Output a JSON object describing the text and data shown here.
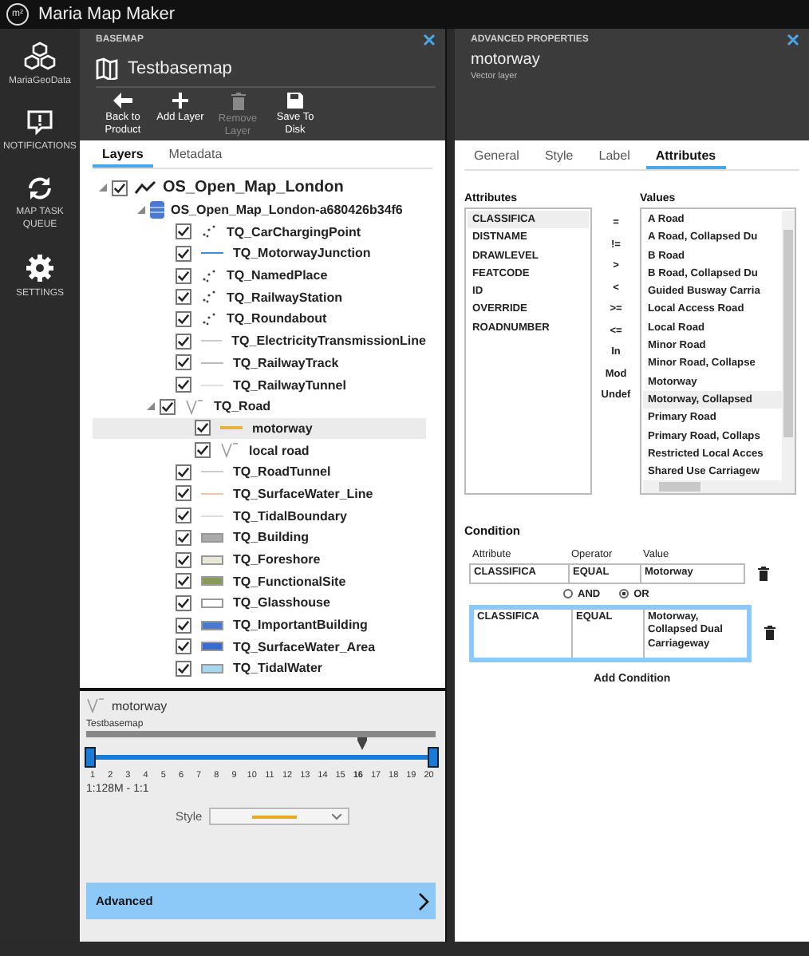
{
  "app": {
    "title": "Maria Map Maker",
    "logo": "m²"
  },
  "sidebar": [
    {
      "label": "MariaGeoData"
    },
    {
      "label": "NOTIFICATIONS"
    },
    {
      "label": "MAP TASK QUEUE"
    },
    {
      "label": "SETTINGS"
    }
  ],
  "basemap": {
    "header": "BASEMAP",
    "title": "Testbasemap",
    "toolbar": [
      {
        "label": "Back to Product",
        "disabled": false
      },
      {
        "label": "Add Layer",
        "disabled": false
      },
      {
        "label": "Remove Layer",
        "disabled": true
      },
      {
        "label": "Save To Disk",
        "disabled": false
      }
    ],
    "tabs": [
      {
        "label": "Layers",
        "selected": true
      },
      {
        "label": "Metadata",
        "selected": false
      }
    ],
    "tree": [
      {
        "label": "OS_Open_Map_London",
        "kind": "group",
        "checked": true,
        "expanded": true,
        "selected": false,
        "children": [
          {
            "label": "OS_Open_Map_London-a680426b34f6",
            "kind": "dataset",
            "expanded": true,
            "selected": false,
            "children": [
              {
                "label": "TQ_CarChargingPoint",
                "kind": "points",
                "checked": true,
                "selected": false
              },
              {
                "label": "TQ_MotorwayJunction",
                "kind": "line",
                "color": "#3a8fd8",
                "checked": true,
                "selected": false
              },
              {
                "label": "TQ_NamedPlace",
                "kind": "points",
                "checked": true,
                "selected": false
              },
              {
                "label": "TQ_RailwayStation",
                "kind": "points",
                "checked": true,
                "selected": false
              },
              {
                "label": "TQ_Roundabout",
                "kind": "points",
                "checked": true,
                "selected": false
              },
              {
                "label": "TQ_ElectricityTransmissionLine",
                "kind": "line",
                "color": "#cccccc",
                "checked": true,
                "selected": false
              },
              {
                "label": "TQ_RailwayTrack",
                "kind": "line",
                "color": "#bbbbbb",
                "checked": true,
                "selected": false
              },
              {
                "label": "TQ_RailwayTunnel",
                "kind": "line",
                "color": "#dddddd",
                "checked": true,
                "selected": false
              },
              {
                "label": "TQ_Road",
                "kind": "road",
                "checked": true,
                "expanded": true,
                "selected": false,
                "children": [
                  {
                    "label": "motorway",
                    "kind": "line",
                    "color": "#e8b040",
                    "checked": true,
                    "selected": true
                  },
                  {
                    "label": "local road",
                    "kind": "road",
                    "checked": true,
                    "selected": false
                  }
                ]
              },
              {
                "label": "TQ_RoadTunnel",
                "kind": "line",
                "color": "#cccccc",
                "checked": true,
                "selected": false
              },
              {
                "label": "TQ_SurfaceWater_Line",
                "kind": "line",
                "color": "#f0c8a8",
                "checked": true,
                "selected": false
              },
              {
                "label": "TQ_TidalBoundary",
                "kind": "line",
                "color": "#dddddd",
                "checked": true,
                "selected": false
              },
              {
                "label": "TQ_Building",
                "kind": "polygon",
                "color": "#aaaaaa",
                "checked": true,
                "selected": false
              },
              {
                "label": "TQ_Foreshore",
                "kind": "polygon",
                "color": "#e8e8d8",
                "checked": true,
                "selected": false
              },
              {
                "label": "TQ_FunctionalSite",
                "kind": "polygon",
                "color": "#8a9a5a",
                "checked": true,
                "selected": false
              },
              {
                "label": "TQ_Glasshouse",
                "kind": "polygon",
                "color": "#ffffff",
                "checked": true,
                "selected": false
              },
              {
                "label": "TQ_ImportantBuilding",
                "kind": "polygon",
                "color": "#4a7ad0",
                "checked": true,
                "selected": false
              },
              {
                "label": "TQ_SurfaceWater_Area",
                "kind": "polygon",
                "color": "#3a6ad0",
                "checked": true,
                "selected": false
              },
              {
                "label": "TQ_TidalWater",
                "kind": "polygon",
                "color": "#a8d8f0",
                "checked": true,
                "selected": false
              }
            ]
          }
        ]
      }
    ]
  },
  "detail": {
    "layer": "motorway",
    "basemap": "Testbasemap",
    "level": 1,
    "ticks": [
      {
        "label": "1",
        "selected": false
      },
      {
        "label": "2",
        "selected": false
      },
      {
        "label": "3",
        "selected": false
      },
      {
        "label": "4",
        "selected": false
      },
      {
        "label": "5",
        "selected": false
      },
      {
        "label": "6",
        "selected": false
      },
      {
        "label": "7",
        "selected": false
      },
      {
        "label": "8",
        "selected": false
      },
      {
        "label": "9",
        "selected": false
      },
      {
        "label": "10",
        "selected": false
      },
      {
        "label": "11",
        "selected": false
      },
      {
        "label": "12",
        "selected": false
      },
      {
        "label": "13",
        "selected": false
      },
      {
        "label": "14",
        "selected": false
      },
      {
        "label": "15",
        "selected": false
      },
      {
        "label": "16",
        "selected": true
      },
      {
        "label": "17",
        "selected": false
      },
      {
        "label": "18",
        "selected": false
      },
      {
        "label": "19",
        "selected": false
      },
      {
        "label": "20",
        "selected": false
      }
    ],
    "scale": "1:128M - 1:1",
    "style_label": "Style",
    "advanced": "Advanced"
  },
  "advanced": {
    "header": "ADVANCED PROPERTIES",
    "title": "motorway",
    "subtitle": "Vector layer",
    "tabs": [
      {
        "label": "General",
        "selected": false
      },
      {
        "label": "Style",
        "selected": false
      },
      {
        "label": "Label",
        "selected": false
      },
      {
        "label": "Attributes",
        "selected": true
      }
    ],
    "attributes_heading": "Attributes",
    "values_heading": "Values",
    "attributes": [
      {
        "label": "CLASSIFICA",
        "selected": true
      },
      {
        "label": "DISTNAME",
        "selected": false
      },
      {
        "label": "DRAWLEVEL",
        "selected": false
      },
      {
        "label": "FEATCODE",
        "selected": false
      },
      {
        "label": "ID",
        "selected": false
      },
      {
        "label": "OVERRIDE",
        "selected": false
      },
      {
        "label": "ROADNUMBER",
        "selected": false
      }
    ],
    "operators": [
      "=",
      "!=",
      ">",
      "<",
      ">=",
      "<=",
      "In",
      "Mod",
      "Undef"
    ],
    "values": [
      {
        "label": "A Road",
        "selected": false
      },
      {
        "label": "A Road, Collapsed Du",
        "selected": false
      },
      {
        "label": "B Road",
        "selected": false
      },
      {
        "label": "B Road, Collapsed Du",
        "selected": false
      },
      {
        "label": "Guided Busway Carria",
        "selected": false
      },
      {
        "label": "Local Access Road",
        "selected": false
      },
      {
        "label": "Local Road",
        "selected": false
      },
      {
        "label": "Minor Road",
        "selected": false
      },
      {
        "label": "Minor Road, Collapse",
        "selected": false
      },
      {
        "label": "Motorway",
        "selected": false
      },
      {
        "label": "Motorway, Collapsed",
        "selected": true
      },
      {
        "label": "Primary Road",
        "selected": false
      },
      {
        "label": "Primary Road, Collaps",
        "selected": false
      },
      {
        "label": "Restricted Local Acces",
        "selected": false
      },
      {
        "label": "Shared Use Carriagew",
        "selected": false
      }
    ],
    "condition": {
      "heading": "Condition",
      "columns": [
        "Attribute",
        "Operator",
        "Value"
      ],
      "rows": [
        {
          "attribute": "CLASSIFICA",
          "operator": "EQUAL",
          "value": "Motorway",
          "selected": false
        },
        {
          "attribute": "CLASSIFICA",
          "operator": "EQUAL",
          "value": "Motorway, Collapsed Dual Carriageway",
          "selected": true
        }
      ],
      "connector": [
        {
          "label": "AND",
          "selected": false
        },
        {
          "label": "OR",
          "selected": true
        }
      ],
      "add": "Add Condition"
    }
  }
}
